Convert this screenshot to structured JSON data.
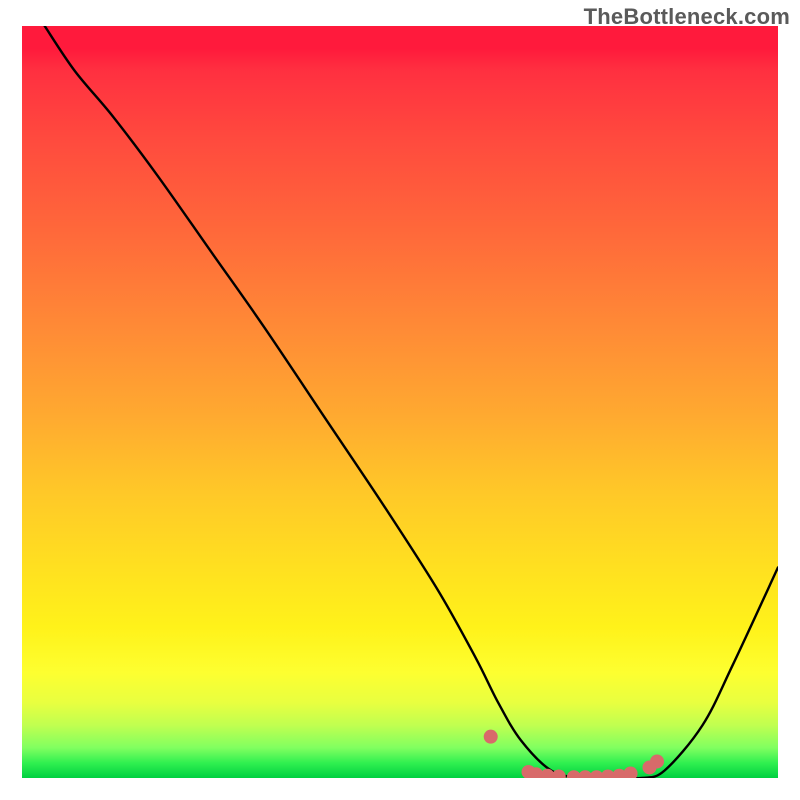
{
  "watermark": "TheBottleneck.com",
  "chart_data": {
    "type": "line",
    "title": "",
    "xlabel": "",
    "ylabel": "",
    "xlim": [
      0,
      100
    ],
    "ylim": [
      0,
      100
    ],
    "series": [
      {
        "name": "curve",
        "x": [
          3,
          7,
          12,
          18,
          25,
          32,
          40,
          48,
          55,
          60,
          63,
          66,
          70,
          74,
          78,
          82,
          85,
          90,
          94,
          100
        ],
        "y": [
          100,
          94,
          88,
          80,
          70,
          60,
          48,
          36,
          25,
          16,
          10,
          5,
          1,
          0,
          0,
          0,
          1,
          7,
          15,
          28
        ]
      }
    ],
    "markers": {
      "name": "valley-dots",
      "color": "#d86a6a",
      "radius_px": 7,
      "x": [
        62,
        67,
        68,
        69.5,
        71,
        73,
        74.5,
        76,
        77.5,
        79,
        80.5,
        83,
        84
      ],
      "y": [
        5.5,
        0.8,
        0.5,
        0.3,
        0.2,
        0.1,
        0.1,
        0.1,
        0.2,
        0.3,
        0.6,
        1.4,
        2.2
      ]
    },
    "background": {
      "type": "vertical-gradient",
      "stops": [
        {
          "pos": 0.0,
          "color": "#ff1a3c"
        },
        {
          "pos": 0.15,
          "color": "#ff4a3e"
        },
        {
          "pos": 0.4,
          "color": "#ff8a36"
        },
        {
          "pos": 0.62,
          "color": "#ffc828"
        },
        {
          "pos": 0.8,
          "color": "#fff21a"
        },
        {
          "pos": 0.93,
          "color": "#c0ff50"
        },
        {
          "pos": 1.0,
          "color": "#00d040"
        }
      ]
    }
  }
}
